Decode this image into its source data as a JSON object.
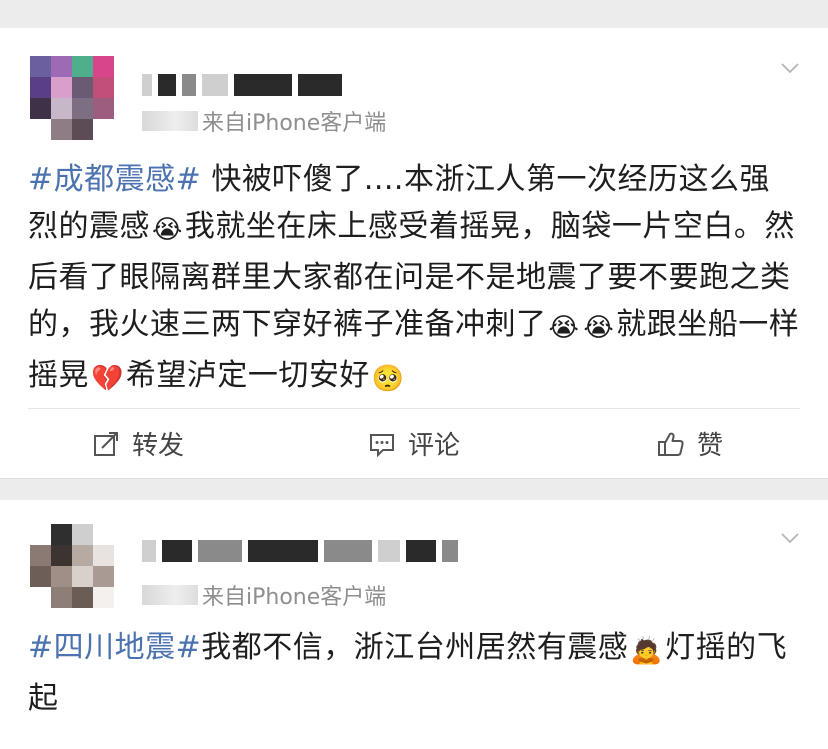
{
  "feed": {
    "posts": [
      {
        "source": "来自iPhone客户端",
        "hashtag": "#成都震感#",
        "segments": {
          "s1": " 快被吓傻了....本浙江人第一次经历这么强烈的震感",
          "s2": "我就坐在床上感受着摇晃，脑袋一片空白。然后看了眼隔离群里大家都在问是不是地震了要不要跑之类的，我火速三两下穿好裤子准备冲刺了",
          "s3": "就跟坐船一样摇晃",
          "s4": "希望泸定一切安好"
        },
        "emoji": {
          "crying": "😭",
          "broken_heart": "💔",
          "worried": "🥺"
        },
        "actions": {
          "repost": "转发",
          "comment": "评论",
          "like": "赞"
        }
      },
      {
        "source": "来自iPhone客户端",
        "hashtag": "#四川地震#",
        "segments": {
          "s1": "我都不信，浙江台州居然有震感",
          "s2": "灯摇的飞起"
        },
        "emoji": {
          "kneel": "🙇"
        }
      }
    ],
    "icons": {
      "chevron": "chevron-down-icon",
      "repost": "edit-share-icon",
      "comment": "comment-bubble-icon",
      "like": "thumbs-up-icon"
    }
  }
}
